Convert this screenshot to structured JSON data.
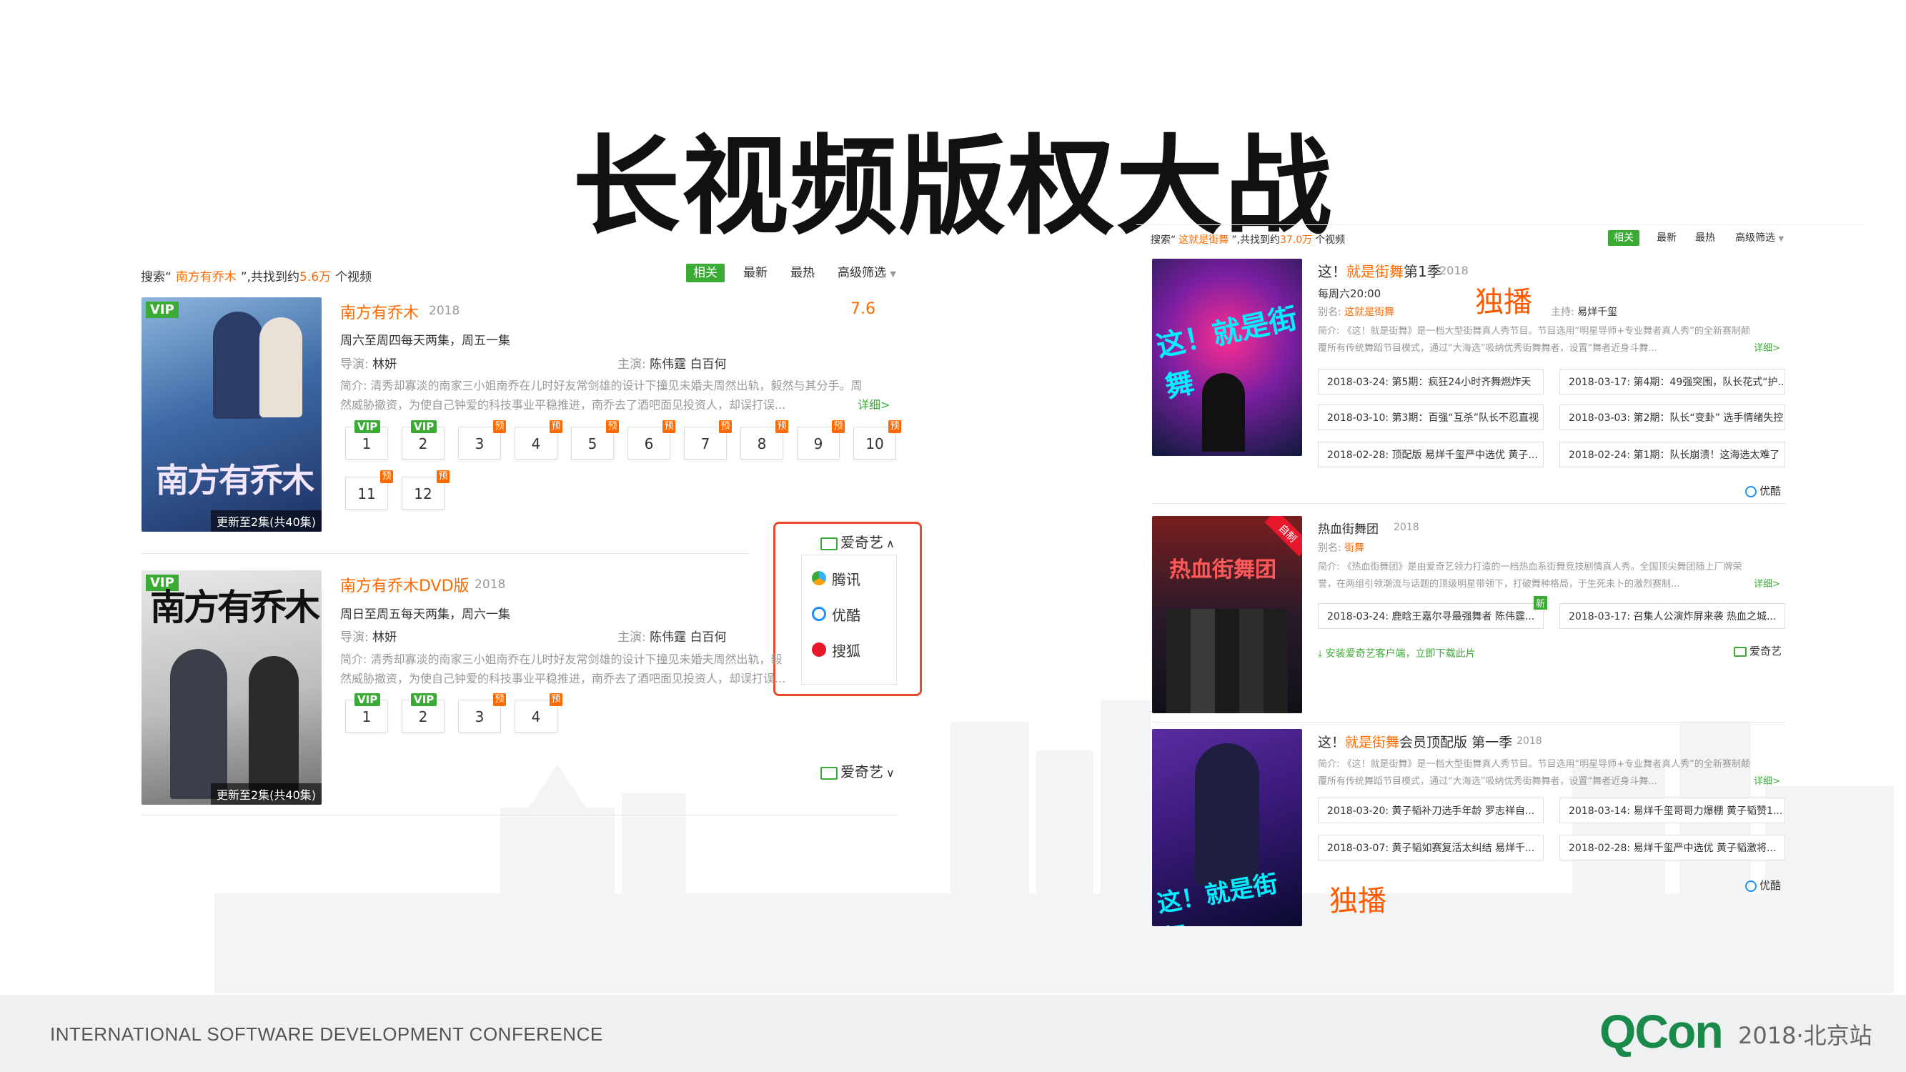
{
  "slide_title": "长视频版权大战",
  "footer": {
    "conference": "INTERNATIONAL SOFTWARE DEVELOPMENT CONFERENCE",
    "logo": "QCon",
    "edition": "2018·北京站"
  },
  "left_panel": {
    "search_prefix": "搜索“",
    "search_term": "南方有乔木",
    "search_mid": "”,共找到约",
    "search_count": "5.6万",
    "search_suffix": "个视频",
    "filters": [
      "相关",
      "最新",
      "最热",
      "高级筛选"
    ],
    "results": [
      {
        "poster_badge": "VIP",
        "poster_title": "南方有乔木",
        "poster_caption": "更新至2集(共40集)",
        "title": "南方有乔木",
        "year": "2018",
        "score": "7.6",
        "schedule": "周六至周四每天两集，周五一集",
        "director_label": "导演:",
        "director": "林妍",
        "cast_label": "主演:",
        "cast": "陈伟霆   白百何",
        "synopsis_label": "简介:",
        "synopsis_line1": "清秀却寡淡的南家三小姐南乔在儿时好友常剑雄的设计下撞见未婚夫周然出轨，毅然与其分手。周",
        "synopsis_line2": "然威胁撤资，为使自己钟爱的科技事业平稳推进，南乔去了酒吧面见投资人，却误打误...",
        "more": "详细>",
        "episodes": [
          {
            "n": "1",
            "tag": "VIP"
          },
          {
            "n": "2",
            "tag": "VIP"
          },
          {
            "n": "3",
            "tag": "预"
          },
          {
            "n": "4",
            "tag": "预"
          },
          {
            "n": "5",
            "tag": "预"
          },
          {
            "n": "6",
            "tag": "预"
          },
          {
            "n": "7",
            "tag": "预"
          },
          {
            "n": "8",
            "tag": "预"
          },
          {
            "n": "9",
            "tag": "预"
          },
          {
            "n": "10",
            "tag": "预"
          },
          {
            "n": "11",
            "tag": "预"
          },
          {
            "n": "12",
            "tag": "预"
          }
        ],
        "source": "爱奇艺",
        "source_menu": [
          "腾讯",
          "优酷",
          "搜狐"
        ]
      },
      {
        "poster_badge": "VIP",
        "poster_title": "南方有乔木",
        "poster_caption": "更新至2集(共40集)",
        "title": "南方有乔木DVD版",
        "year": "2018",
        "schedule": "周日至周五每天两集，周六一集",
        "director_label": "导演:",
        "director": "林妍",
        "cast_label": "主演:",
        "cast": "陈伟霆   白百何",
        "synopsis_label": "简介:",
        "synopsis_line1": "清秀却寡淡的南家三小姐南乔在儿时好友常剑雄的设计下撞见未婚夫周然出轨，毅",
        "synopsis_line2": "然威胁撤资，为使自己钟爱的科技事业平稳推进，南乔去了酒吧面见投资人，却误打误...",
        "episodes": [
          {
            "n": "1",
            "tag": "VIP"
          },
          {
            "n": "2",
            "tag": "VIP"
          },
          {
            "n": "3",
            "tag": "预"
          },
          {
            "n": "4",
            "tag": "预"
          }
        ],
        "source": "爱奇艺"
      }
    ]
  },
  "right_panel": {
    "search_prefix": "搜索“",
    "search_term": "这就是街舞",
    "search_mid": "”,共找到约",
    "search_count": "37.0万",
    "search_suffix": "个视频",
    "filters": [
      "相关",
      "最新",
      "最热",
      "高级筛选"
    ],
    "annotation_exclusive": "独播",
    "results": [
      {
        "poster_text": "这！就是街舞",
        "title_a": "这！",
        "title_b": "就是街舞",
        "title_c": "第1季",
        "year": "2018",
        "schedule": "每周六20:00",
        "alias_label": "别名:",
        "alias": "这就是街舞",
        "host_label": "主持:",
        "host": "易烊千玺",
        "synopsis_line1": "简介: 《这！就是街舞》是一档大型街舞真人秀节目。节目选用“明星导师+专业舞者真人秀”的全新赛制颠",
        "synopsis_line2": "覆所有传统舞蹈节目模式，通过“大海选”吸纳优秀街舞舞者，设置“舞者近身斗舞...",
        "more": "详细>",
        "episodes": [
          "2018-03-24: 第5期：疯狂24小时齐舞燃炸天",
          "2018-03-17: 第4期：49强突围，队长花式“护...",
          "2018-03-10: 第3期：百强“互杀”队长不忍直视",
          "2018-03-03: 第2期：队长“变卦” 选手情绪失控",
          "2018-02-28: 顶配版 易烊千玺严中选优 黄子...",
          "2018-02-24: 第1期：队长崩溃！这海选太难了"
        ],
        "source": "优酷"
      },
      {
        "poster_text": "热血街舞团",
        "poster_corner": "自制",
        "title": "热血街舞团",
        "year": "2018",
        "alias_label": "别名:",
        "alias": "街舞",
        "synopsis_line1": "简介: 《热血街舞团》是由爱奇艺领力打造的一档热血系街舞竞技剧情真人秀。全国顶尖舞团随上厂牌荣",
        "synopsis_line2": "誉，在两组引领潮流与话题的顶级明星带领下，打破舞种格局，于生死未卜的激烈赛制...",
        "more": "详细>",
        "new_tag": "新",
        "episodes": [
          "2018-03-24: 鹿晗王嘉尔寻最强舞者 陈伟霆...",
          "2018-03-17: 召集人公演炸屏来袭 热血之城..."
        ],
        "download": "安装爱奇艺客户端，立即下载此片",
        "source": "爱奇艺"
      },
      {
        "poster_text": "这！就是街舞",
        "title_a": "这！",
        "title_b": "就是街舞",
        "title_c": "会员顶配版 第一季",
        "year": "2018",
        "synopsis_line1": "简介: 《这！就是街舞》是一档大型街舞真人秀节目。节目选用“明星导师+专业舞者真人秀”的全新赛制颠",
        "synopsis_line2": "覆所有传统舞蹈节目模式，通过“大海选”吸纳优秀街舞舞者，设置“舞者近身斗舞...",
        "more": "详细>",
        "episodes": [
          "2018-03-20: 黄子韬补刀选手年龄 罗志祥自...",
          "2018-03-14: 易烊千玺哥哥力爆棚 黄子韬赞1...",
          "2018-03-07: 黄子韬如赛复活太纠结 易烊千...",
          "2018-02-28: 易烊千玺严中选优 黄子韬激将..."
        ],
        "source": "优酷"
      }
    ]
  }
}
